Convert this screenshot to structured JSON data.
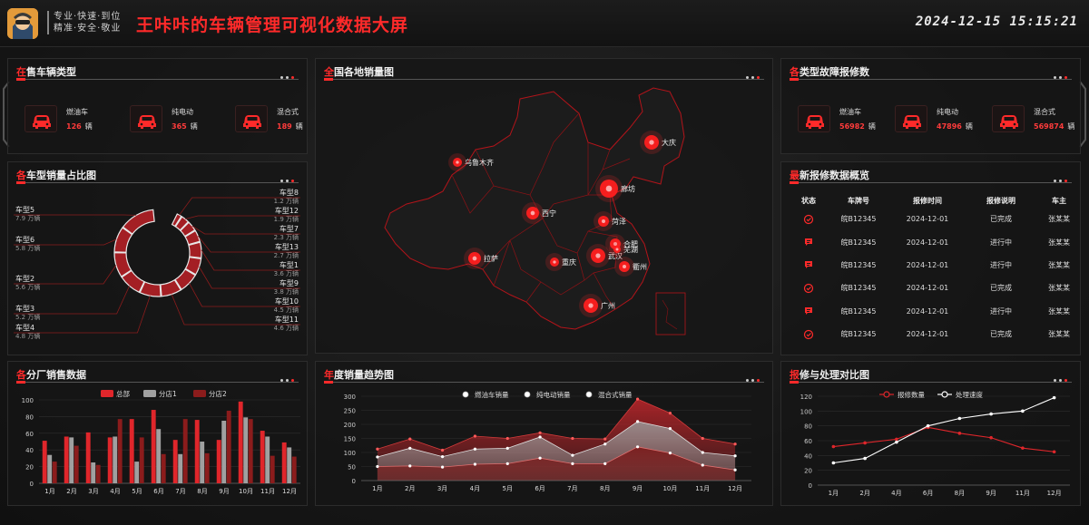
{
  "header": {
    "slogan_line1": "专业·快速·到位",
    "slogan_line2": "精准·安全·敬业",
    "title": "王咔咔的车辆管理可视化数据大屏",
    "datetime": "2024-12-15  15:15:21"
  },
  "colors": {
    "accent": "#ff2a2a",
    "bg": "#141414",
    "white": "#ffffff",
    "gray": "#a0a0a0",
    "darkred": "#8b1c1c"
  },
  "on_sale": {
    "title_first": "在",
    "title_rest": "售车辆类型",
    "items": [
      {
        "name": "燃油车",
        "value": "126",
        "unit": "辆",
        "icon": "car-icon"
      },
      {
        "name": "纯电动",
        "value": "365",
        "unit": "辆",
        "icon": "car-icon"
      },
      {
        "name": "混合式",
        "value": "189",
        "unit": "辆",
        "icon": "car-icon"
      }
    ]
  },
  "fault": {
    "title_first": "各",
    "title_rest": "类型故障报修数",
    "items": [
      {
        "name": "燃油车",
        "value": "56982",
        "unit": "辆",
        "icon": "car-icon"
      },
      {
        "name": "纯电动",
        "value": "47896",
        "unit": "辆",
        "icon": "car-icon"
      },
      {
        "name": "混合式",
        "value": "569874",
        "unit": "辆",
        "icon": "car-icon"
      }
    ]
  },
  "share": {
    "title_first": "各",
    "title_rest": "车型销量占比图",
    "unit": "万辆"
  },
  "map": {
    "title_first": "全",
    "title_rest": "国各地销量图",
    "cities": [
      {
        "name": "乌鲁木齐"
      },
      {
        "name": "大庆"
      },
      {
        "name": "西宁"
      },
      {
        "name": "菏泽"
      },
      {
        "name": "廊坊"
      },
      {
        "name": "拉萨"
      },
      {
        "name": "重庆"
      },
      {
        "name": "武汉"
      },
      {
        "name": "合肥"
      },
      {
        "name": "芜湖"
      },
      {
        "name": "衢州"
      },
      {
        "name": "广州"
      }
    ]
  },
  "repair": {
    "title_first": "最",
    "title_rest": "新报修数据概览",
    "columns": [
      "状态",
      "车牌号",
      "报修时间",
      "报修说明",
      "车主"
    ],
    "rows": [
      {
        "plate": "皖B12345",
        "date": "2024-12-01",
        "desc": "已完成",
        "status": "done",
        "owner": "张某某"
      },
      {
        "plate": "皖B12345",
        "date": "2024-12-01",
        "desc": "进行中",
        "status": "ing",
        "owner": "张某某"
      },
      {
        "plate": "皖B12345",
        "date": "2024-12-01",
        "desc": "进行中",
        "status": "ing",
        "owner": "张某某"
      },
      {
        "plate": "皖B12345",
        "date": "2024-12-01",
        "desc": "已完成",
        "status": "done",
        "owner": "张某某"
      },
      {
        "plate": "皖B12345",
        "date": "2024-12-01",
        "desc": "进行中",
        "status": "ing",
        "owner": "张某某"
      },
      {
        "plate": "皖B12345",
        "date": "2024-12-01",
        "desc": "已完成",
        "status": "done",
        "owner": "张某某"
      }
    ]
  },
  "factory": {
    "title_first": "各",
    "title_rest": "分厂销售数据"
  },
  "trend": {
    "title_first": "年",
    "title_rest": "度销量趋势图"
  },
  "compare": {
    "title_first": "报",
    "title_rest": "修与处理对比图"
  },
  "chart_data": [
    {
      "id": "share",
      "type": "pie",
      "unit": "万辆",
      "slices": [
        {
          "name": "车型8",
          "value": 1.2
        },
        {
          "name": "车型12",
          "value": 1.9
        },
        {
          "name": "车型7",
          "value": 2.3
        },
        {
          "name": "车型13",
          "value": 2.7
        },
        {
          "name": "车型1",
          "value": 3.6
        },
        {
          "name": "车型9",
          "value": 3.8
        },
        {
          "name": "车型10",
          "value": 4.5
        },
        {
          "name": "车型11",
          "value": 4.6
        },
        {
          "name": "车型4",
          "value": 4.8
        },
        {
          "name": "车型3",
          "value": 5.2
        },
        {
          "name": "车型2",
          "value": 5.6
        },
        {
          "name": "车型6",
          "value": 5.8
        },
        {
          "name": "车型5",
          "value": 7.9
        }
      ]
    },
    {
      "id": "factory",
      "type": "bar",
      "categories": [
        "1月",
        "2月",
        "3月",
        "4月",
        "5月",
        "6月",
        "7月",
        "8月",
        "9月",
        "10月",
        "11月",
        "12月"
      ],
      "series": [
        {
          "name": "总部",
          "color": "#e0262b",
          "values": [
            51,
            56,
            61,
            55,
            77,
            88,
            52,
            76,
            52,
            98,
            63,
            49
          ]
        },
        {
          "name": "分店1",
          "color": "#a0a0a0",
          "values": [
            34,
            55,
            25,
            56,
            26,
            65,
            35,
            50,
            75,
            79,
            56,
            43
          ]
        },
        {
          "name": "分店2",
          "color": "#8b1c1c",
          "values": [
            26,
            45,
            22,
            77,
            55,
            35,
            77,
            36,
            87,
            77,
            33,
            32
          ]
        }
      ],
      "ylim": [
        0,
        100
      ],
      "yticks": [
        0,
        20,
        40,
        60,
        80,
        100
      ],
      "legend": "top"
    },
    {
      "id": "trend",
      "type": "area",
      "categories": [
        "1月",
        "2月",
        "3月",
        "4月",
        "5月",
        "6月",
        "7月",
        "8月",
        "9月",
        "10月",
        "11月",
        "12月"
      ],
      "series": [
        {
          "name": "燃油车销量",
          "values": [
            112,
            148,
            108,
            158,
            150,
            170,
            150,
            148,
            290,
            240,
            150,
            130
          ]
        },
        {
          "name": "纯电动销量",
          "values": [
            84,
            115,
            85,
            112,
            115,
            155,
            90,
            130,
            210,
            185,
            100,
            88
          ]
        },
        {
          "name": "混合式销量",
          "values": [
            50,
            52,
            48,
            58,
            60,
            80,
            60,
            60,
            120,
            98,
            55,
            38
          ]
        }
      ],
      "ylim": [
        0,
        300
      ],
      "yticks": [
        0,
        50,
        100,
        150,
        200,
        250,
        300
      ],
      "legend": "top"
    },
    {
      "id": "compare",
      "type": "line",
      "categories": [
        "1月",
        "2月",
        "4月",
        "6月",
        "8月",
        "9月",
        "11月",
        "12月"
      ],
      "series": [
        {
          "name": "报修数量",
          "color": "#e0262b",
          "values": [
            52,
            57,
            62,
            78,
            70,
            64,
            50,
            45
          ]
        },
        {
          "name": "处理速度",
          "color": "#ffffff",
          "values": [
            30,
            36,
            58,
            80,
            90,
            96,
            100,
            118
          ]
        }
      ],
      "ylim": [
        0,
        120
      ],
      "yticks": [
        0,
        20,
        40,
        60,
        80,
        100,
        120
      ],
      "legend": "top"
    }
  ]
}
